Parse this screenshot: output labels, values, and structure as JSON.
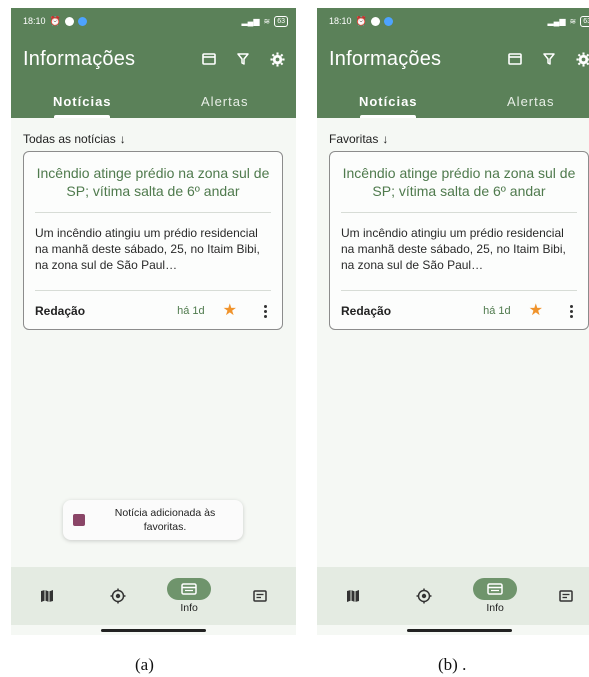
{
  "status": {
    "time": "18:10",
    "battery": "63"
  },
  "colors": {
    "primary": "#5b8159",
    "card_title": "#4f7a4d",
    "star": "#f0932b",
    "nav_bg": "#e4ebe2",
    "nav_active": "#6f946c"
  },
  "appbar": {
    "title": "Informações",
    "icons": [
      "view-icon",
      "filter-icon",
      "settings-icon"
    ]
  },
  "tabs": [
    {
      "label": "Notícias",
      "active": true
    },
    {
      "label": "Alertas",
      "active": false
    }
  ],
  "screens": [
    {
      "filter_label": "Todas as notícias",
      "card": {
        "title": "Incêndio atinge prédio na zona sul de SP; vítima salta de 6º andar",
        "body": "Um incêndio atingiu um prédio residencial na manhã deste sábado, 25, no Itaim Bibi, na zona sul de São Paul…",
        "author": "Redação",
        "age": "há 1d",
        "favorited": true
      },
      "toast": "Notícia adicionada às favoritas.",
      "caption": "(a)"
    },
    {
      "filter_label": "Favoritas",
      "card": {
        "title": "Incêndio atinge prédio na zona sul de SP; vítima salta de 6º andar",
        "body": "Um incêndio atingiu um prédio residencial na manhã deste sábado, 25, no Itaim Bibi, na zona sul de São Paul…",
        "author": "Redação",
        "age": "há 1d",
        "favorited": true
      },
      "caption": "(b) ."
    }
  ],
  "bottomnav": [
    {
      "icon": "map-icon",
      "label": ""
    },
    {
      "icon": "location-icon",
      "label": ""
    },
    {
      "icon": "info-icon",
      "label": "Info",
      "active": true
    },
    {
      "icon": "news-icon",
      "label": ""
    }
  ]
}
